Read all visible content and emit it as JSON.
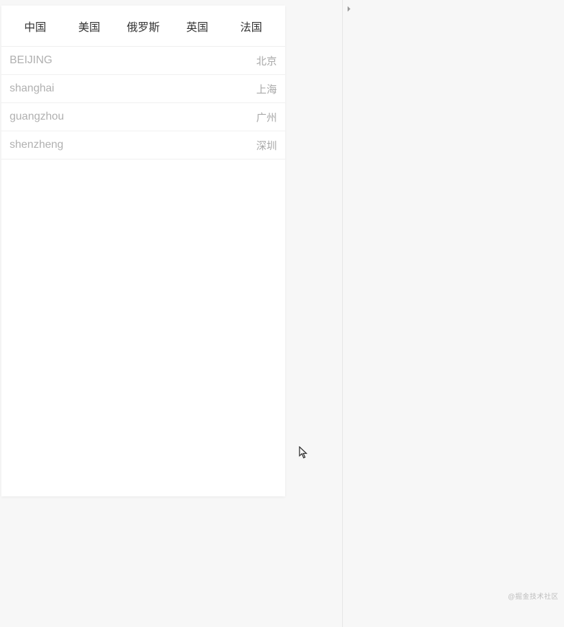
{
  "tabs": {
    "items": [
      {
        "label": "中国"
      },
      {
        "label": "美国"
      },
      {
        "label": "俄罗斯"
      },
      {
        "label": "英国"
      },
      {
        "label": "法国"
      }
    ]
  },
  "list": {
    "rows": [
      {
        "left": "BEIJING",
        "right": "北京"
      },
      {
        "left": "shanghai",
        "right": "上海"
      },
      {
        "left": "guangzhou",
        "right": "广州"
      },
      {
        "left": "shenzheng",
        "right": "深圳"
      }
    ]
  },
  "watermark": {
    "text": "@掘金技术社区"
  }
}
